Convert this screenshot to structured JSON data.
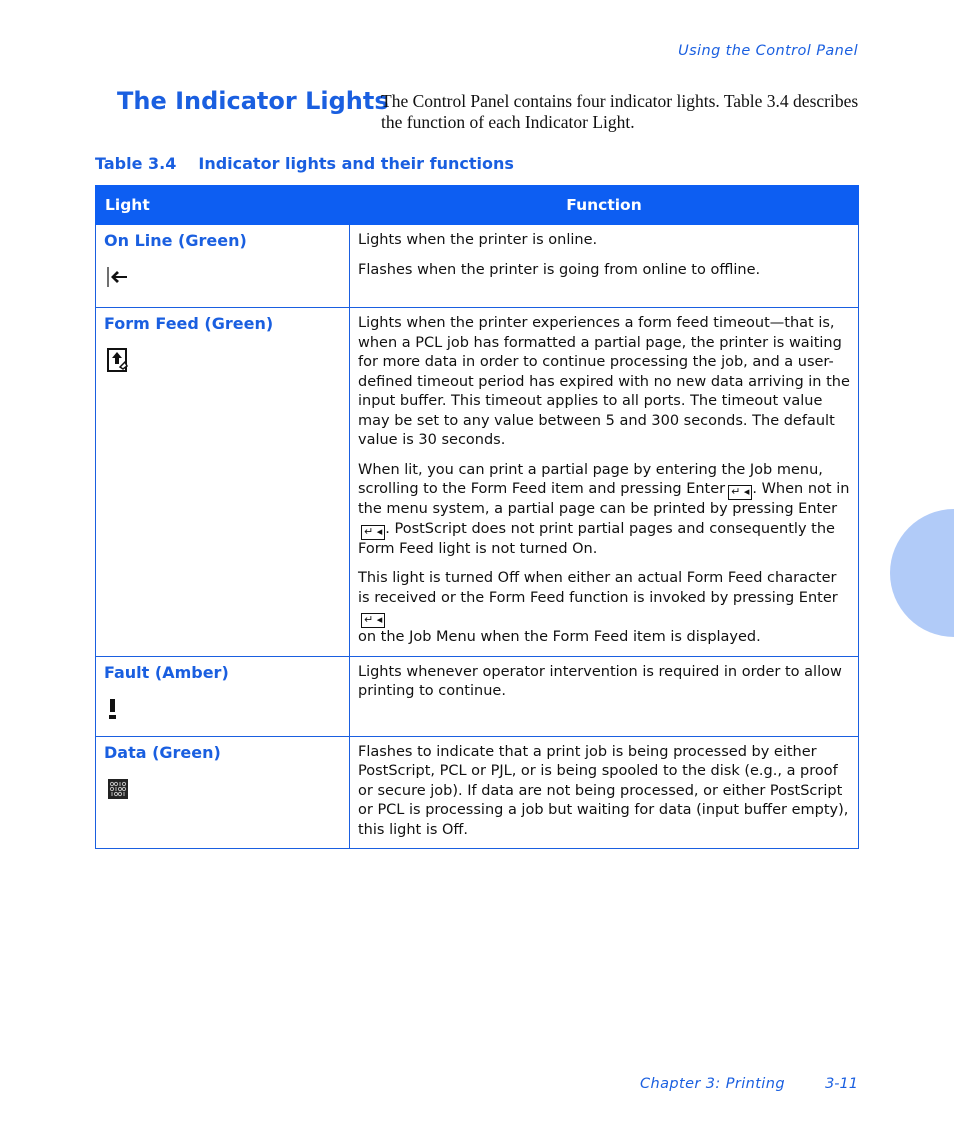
{
  "header": {
    "running_title": "Using the Control Panel"
  },
  "section": {
    "title": "The Indicator Lights",
    "intro": "The Control Panel contains four indicator lights. Table 3.4 describes the function of each Indicator Light."
  },
  "table": {
    "caption_number": "Table 3.4",
    "caption_title": "Indicator lights and their functions",
    "columns": [
      "Light",
      "Function"
    ],
    "rows": [
      {
        "light": "On Line (Green)",
        "icon": "online-arrow-icon",
        "function": [
          "Lights when the printer is online.",
          "Flashes when the printer is going from online to offline."
        ]
      },
      {
        "light": "Form Feed (Green)",
        "icon": "form-feed-page-icon",
        "function": [
          "Lights when the printer experiences a form feed timeout—that is, when a PCL job has formatted a partial page, the printer is waiting for more data in order to continue processing the job, and a user-defined timeout period has expired with no new data arriving in the input buffer. This timeout applies to all ports. The timeout value may be set to any value between 5 and 300 seconds. The default value is 30 seconds.",
          {
            "p1": "When lit, you can print a partial page by entering the Job menu, scrolling to the Form Feed item and pressing Enter",
            "p2": ". When not in the menu system, a partial page can be printed by pressing Enter",
            "p3": ". PostScript does not print partial pages and consequently the Form Feed light is not turned On."
          },
          {
            "p1": "This light is turned Off when either an actual Form Feed character is received or the Form Feed function is invoked by pressing Enter",
            "p2": " on the Job Menu when the Form Feed item is displayed."
          }
        ]
      },
      {
        "light": "Fault (Amber)",
        "icon": "fault-exclamation-icon",
        "function": [
          "Lights whenever operator intervention is required in order to allow printing to continue."
        ]
      },
      {
        "light": "Data (Green)",
        "icon": "data-binary-icon",
        "function": [
          "Flashes to indicate that a print job is being processed by either PostScript, PCL or PJL, or is being spooled to the disk (e.g., a proof or secure job). If data are not being processed, or either PostScript or PCL is processing a job but waiting for data (input buffer empty), this light is Off."
        ]
      }
    ],
    "enter_key_glyph": "↵ ◂"
  },
  "footer": {
    "chapter": "Chapter 3: Printing",
    "page": "3-11"
  },
  "colors": {
    "accent": "#1a5fe0",
    "header_fill": "#0d5ef2",
    "side_tab": "#b1cbf8"
  }
}
